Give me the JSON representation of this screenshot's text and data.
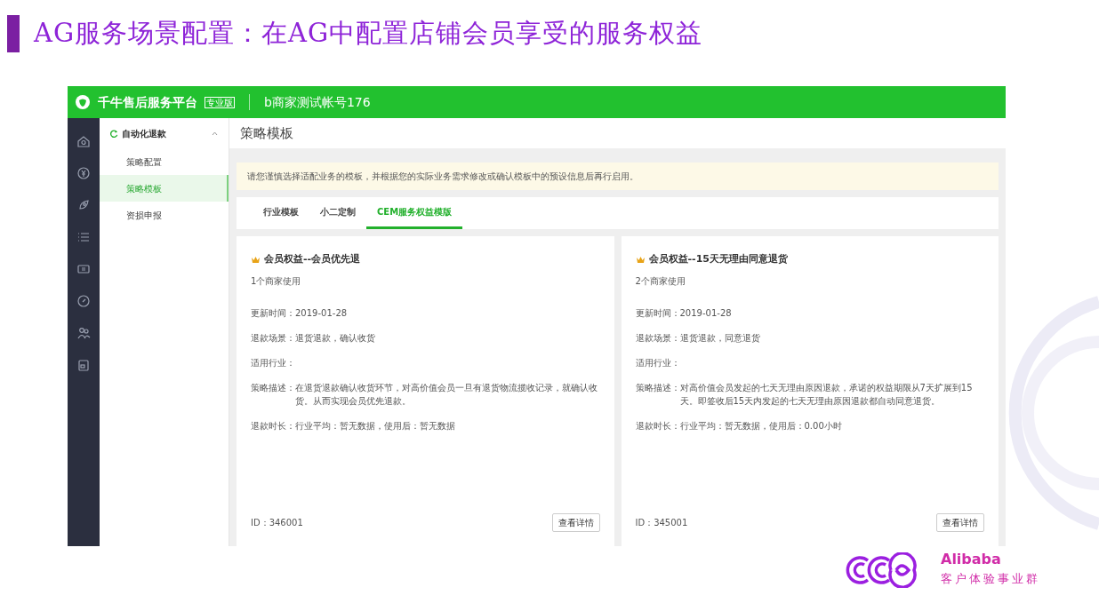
{
  "slide": {
    "title": "AG服务场景配置：在AG中配置店铺会员享受的服务权益"
  },
  "app": {
    "brand": "千牛售后服务平台",
    "brand_badge": "专业版",
    "account": "b商家测试帐号176"
  },
  "submenu": {
    "group": "自动化退款",
    "expanded": true,
    "items": [
      {
        "label": "策略配置",
        "selected": false
      },
      {
        "label": "策略模板",
        "selected": true
      },
      {
        "label": "资损申报",
        "selected": false
      }
    ]
  },
  "page_title": "策略模板",
  "notice": "请您谨慎选择适配业务的模板，并根据您的实际业务需求修改或确认模板中的预设信息后再行启用。",
  "tabs": [
    {
      "label": "行业模板",
      "selected": false
    },
    {
      "label": "小二定制",
      "selected": false
    },
    {
      "label": "CEM服务权益模版",
      "selected": true
    }
  ],
  "cards": [
    {
      "title": "会员权益--会员优先退",
      "usage": "1个商家使用",
      "fields": [
        {
          "label": "更新时间：",
          "value": "2019-01-28"
        },
        {
          "label": "退款场景：",
          "value": "退货退款，确认收货"
        },
        {
          "label": "适用行业："
        },
        {
          "label": "策略描述：",
          "value": "在退货退款确认收货环节，对高价值会员一旦有退货物流揽收记录，就确认收货。从而实现会员优先退款。"
        },
        {
          "label": "退款时长：",
          "value": "行业平均：暂无数据，使用后：暂无数据"
        }
      ],
      "id": "ID：346001",
      "button": "查看详情"
    },
    {
      "title": "会员权益--15天无理由同意退货",
      "usage": "2个商家使用",
      "fields": [
        {
          "label": "更新时间：",
          "value": "2019-01-28"
        },
        {
          "label": "退款场景：",
          "value": "退货退款，同意退货"
        },
        {
          "label": "适用行业："
        },
        {
          "label": "策略描述：",
          "value": "对高价值会员发起的七天无理由原因退款，承诺的权益期限从7天扩展到15天。即签收后15天内发起的七天无理由原因退款都自动同意退货。"
        },
        {
          "label": "退款时长：",
          "value": "行业平均：暂无数据，使用后：0.00小时"
        }
      ],
      "id": "ID：345001",
      "button": "查看详情"
    }
  ],
  "footer": {
    "brand": "Alibaba",
    "division": "客户体验事业群"
  }
}
